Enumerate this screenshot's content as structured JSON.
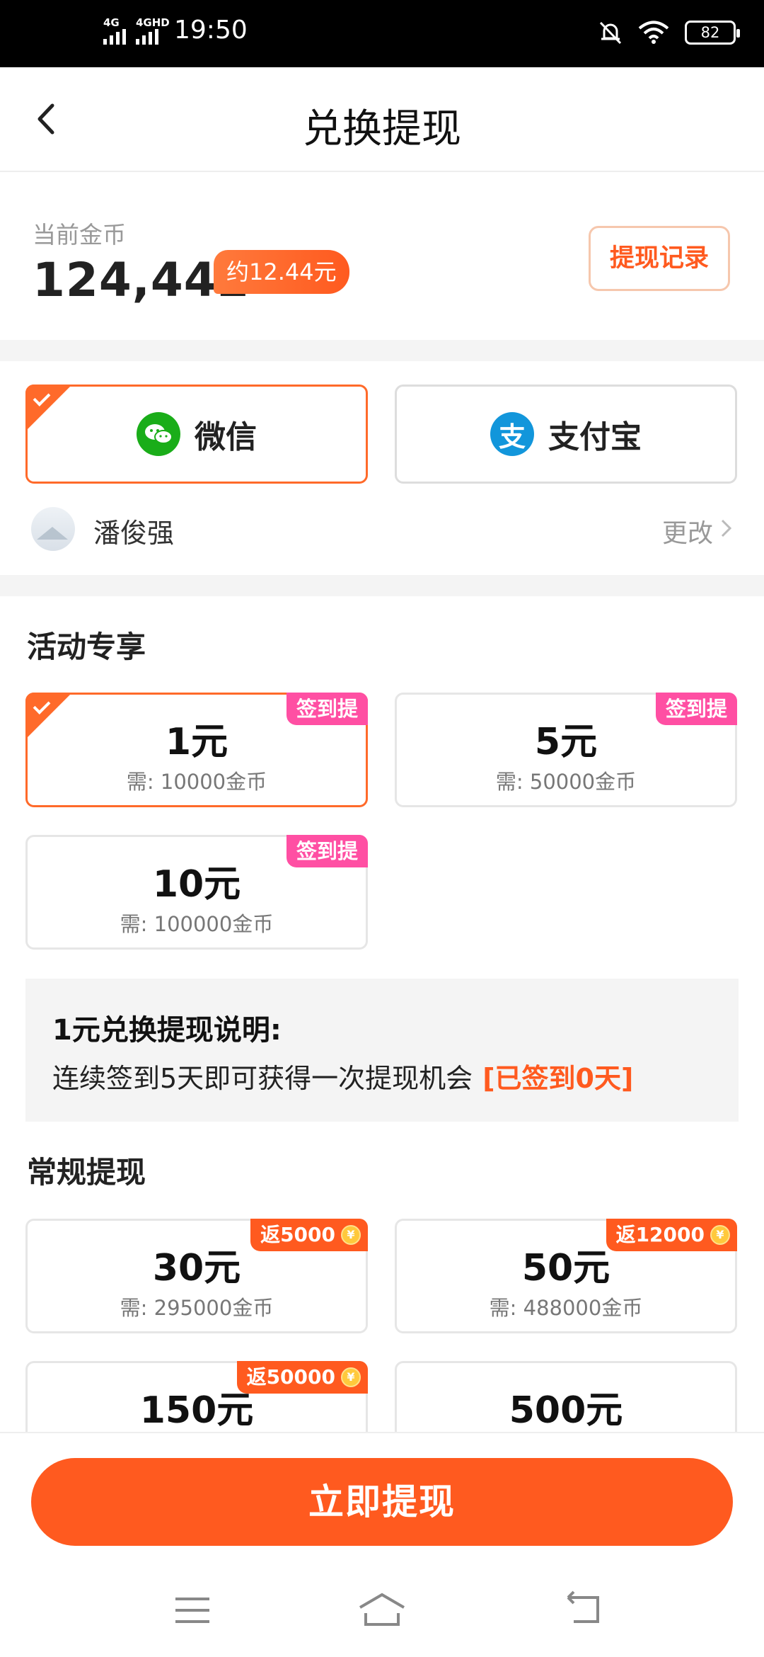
{
  "status_bar": {
    "time": "19:50",
    "sim1": "4G",
    "sim2": "4GHD",
    "battery": "82"
  },
  "header": {
    "title": "兑换提现"
  },
  "coins": {
    "label": "当前金币",
    "amount": "124,442",
    "approx": "约12.44元",
    "record_button": "提现记录"
  },
  "payment": {
    "methods": [
      {
        "label": "微信",
        "selected": true,
        "color": "#1aad19"
      },
      {
        "label": "支付宝",
        "selected": false,
        "color": "#1296db"
      }
    ],
    "user_name": "潘俊强",
    "change_label": "更改"
  },
  "activity": {
    "title": "活动专享",
    "options": [
      {
        "amount": "1元",
        "need": "需: 10000金币",
        "tag": "签到提",
        "selected": true
      },
      {
        "amount": "5元",
        "need": "需: 50000金币",
        "tag": "签到提",
        "selected": false
      },
      {
        "amount": "10元",
        "need": "需: 100000金币",
        "tag": "签到提",
        "selected": false
      }
    ]
  },
  "explain": {
    "heading": "1元兑换提现说明:",
    "text": "连续签到5天即可获得一次提现机会",
    "highlight": "[已签到0天]"
  },
  "regular": {
    "title": "常规提现",
    "options": [
      {
        "amount": "30元",
        "need": "需: 295000金币",
        "tag": "返5000"
      },
      {
        "amount": "50元",
        "need": "需: 488000金币",
        "tag": "返12000"
      },
      {
        "amount": "150元",
        "need": "",
        "tag": "返50000"
      },
      {
        "amount": "500元",
        "need": "",
        "tag": ""
      }
    ]
  },
  "action": {
    "withdraw_button": "立即提现"
  },
  "colors": {
    "accent": "#ff5a1f",
    "tag_pink": "#ff4fa3"
  }
}
